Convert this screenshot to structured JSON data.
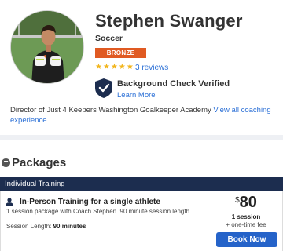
{
  "coach": {
    "name": "Stephen Swanger",
    "sport": "Soccer",
    "level_badge": "BRONZE",
    "rating": 5,
    "stars": [
      "★",
      "★",
      "★",
      "★",
      "★"
    ],
    "reviews_link": "3 reviews",
    "background_check": "Background Check Verified",
    "learn_more": "Learn More",
    "bio": "Director of Just 4 Keepers Washington Goalkeeper Academy",
    "bio_link": "View all coaching experience"
  },
  "packages": {
    "title": "Packages",
    "collapse_symbol": "−",
    "group_label": "Individual Training",
    "items": [
      {
        "name": "In-Person Training for a single athlete",
        "description": "1 session package with Coach Stephen. 90 minute session length",
        "length_label": "Session Length:",
        "length_value": "90 minutes",
        "currency": "$",
        "price": "80",
        "sessions": "1 session",
        "fee": "+ one-time fee",
        "book_label": "Book Now"
      }
    ]
  },
  "colors": {
    "badge": "#e05a22",
    "link": "#2a6fd6",
    "group_bar": "#1c2d4f",
    "button": "#2563c9",
    "star": "#f2b51c",
    "shield": "#1c2d4f"
  },
  "icons": {
    "shield": "shield-check-icon",
    "person": "person-icon",
    "collapse": "minus-circle-icon",
    "star": "star-icon"
  }
}
